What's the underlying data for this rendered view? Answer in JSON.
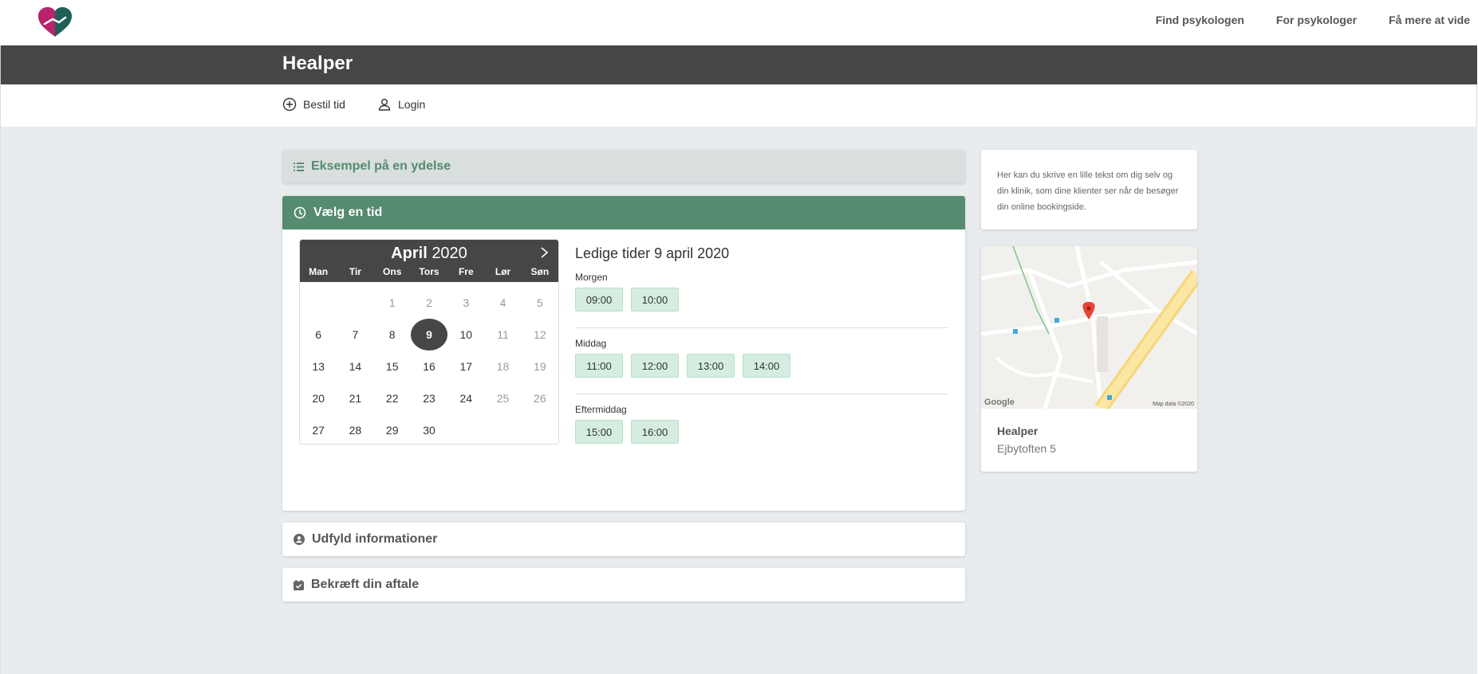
{
  "topnav": {
    "links": [
      "Find psykologen",
      "For psykologer",
      "Få mere at vide"
    ]
  },
  "header": {
    "title": "Healper"
  },
  "subnav": {
    "book": "Bestil tid",
    "login": "Login"
  },
  "steps": {
    "service": "Eksempel på en ydelse",
    "choose_time": "Vælg en tid",
    "fill_info": "Udfyld informationer",
    "confirm": "Bekræft din aftale"
  },
  "calendar": {
    "month": "April",
    "year": "2020",
    "weekdays": [
      "Man",
      "Tir",
      "Ons",
      "Tors",
      "Fre",
      "Lør",
      "Søn"
    ],
    "selected_day": "9"
  },
  "slots": {
    "title": "Ledige tider 9 april 2020",
    "groups": [
      {
        "label": "Morgen",
        "times": [
          "09:00",
          "10:00"
        ]
      },
      {
        "label": "Middag",
        "times": [
          "11:00",
          "12:00",
          "13:00",
          "14:00"
        ]
      },
      {
        "label": "Eftermiddag",
        "times": [
          "15:00",
          "16:00"
        ]
      }
    ]
  },
  "about": {
    "text": "Her kan du skrive en lille tekst om dig selv og din klinik, som dine klienter ser når de besøger din online bookingside."
  },
  "location": {
    "name": "Healper",
    "address": "Ejbytoften 5",
    "map_attribution": "Map data ©2020",
    "map_logo": "Google"
  },
  "colors": {
    "accent": "#558b6e",
    "dark": "#464646",
    "slot_bg": "#d4ede0"
  }
}
